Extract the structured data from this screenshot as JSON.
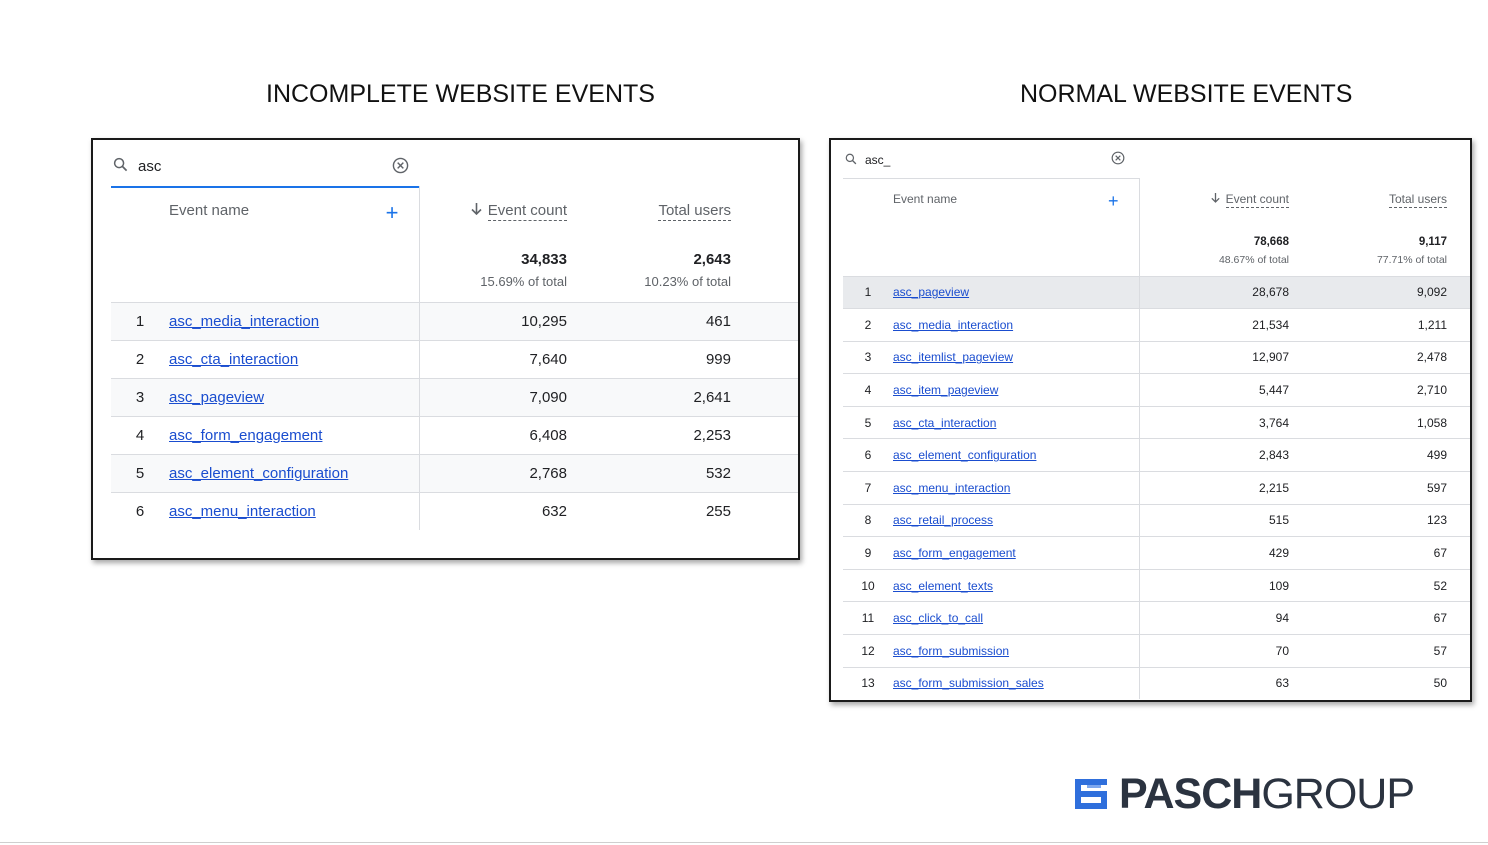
{
  "left": {
    "heading": "INCOMPLETE WEBSITE EVENTS",
    "search_value": "asc",
    "col_event_name": "Event name",
    "col_event_count": "Event count",
    "col_total_users": "Total users",
    "total_event_count": "34,833",
    "total_event_count_pct": "15.69% of total",
    "total_users": "2,643",
    "total_users_pct": "10.23% of total",
    "rows": [
      {
        "idx": "1",
        "name": "asc_media_interaction",
        "count": "10,295",
        "users": "461"
      },
      {
        "idx": "2",
        "name": "asc_cta_interaction",
        "count": "7,640",
        "users": "999"
      },
      {
        "idx": "3",
        "name": "asc_pageview",
        "count": "7,090",
        "users": "2,641"
      },
      {
        "idx": "4",
        "name": "asc_form_engagement",
        "count": "6,408",
        "users": "2,253"
      },
      {
        "idx": "5",
        "name": "asc_element_configuration",
        "count": "2,768",
        "users": "532"
      },
      {
        "idx": "6",
        "name": "asc_menu_interaction",
        "count": "632",
        "users": "255"
      }
    ]
  },
  "right": {
    "heading": "NORMAL WEBSITE EVENTS",
    "search_value": "asc_",
    "col_event_name": "Event name",
    "col_event_count": "Event count",
    "col_total_users": "Total users",
    "total_event_count": "78,668",
    "total_event_count_pct": "48.67% of total",
    "total_users": "9,117",
    "total_users_pct": "77.71% of total",
    "rows": [
      {
        "idx": "1",
        "name": "asc_pageview",
        "count": "28,678",
        "users": "9,092"
      },
      {
        "idx": "2",
        "name": "asc_media_interaction",
        "count": "21,534",
        "users": "1,211"
      },
      {
        "idx": "3",
        "name": "asc_itemlist_pageview",
        "count": "12,907",
        "users": "2,478"
      },
      {
        "idx": "4",
        "name": "asc_item_pageview",
        "count": "5,447",
        "users": "2,710"
      },
      {
        "idx": "5",
        "name": "asc_cta_interaction",
        "count": "3,764",
        "users": "1,058"
      },
      {
        "idx": "6",
        "name": "asc_element_configuration",
        "count": "2,843",
        "users": "499"
      },
      {
        "idx": "7",
        "name": "asc_menu_interaction",
        "count": "2,215",
        "users": "597"
      },
      {
        "idx": "8",
        "name": "asc_retail_process",
        "count": "515",
        "users": "123"
      },
      {
        "idx": "9",
        "name": "asc_form_engagement",
        "count": "429",
        "users": "67"
      },
      {
        "idx": "10",
        "name": "asc_element_texts",
        "count": "109",
        "users": "52"
      },
      {
        "idx": "11",
        "name": "asc_click_to_call",
        "count": "94",
        "users": "67"
      },
      {
        "idx": "12",
        "name": "asc_form_submission",
        "count": "70",
        "users": "57"
      },
      {
        "idx": "13",
        "name": "asc_form_submission_sales",
        "count": "63",
        "users": "50"
      }
    ]
  },
  "icons": {
    "search": "search-icon",
    "clear": "clear-circle-icon",
    "sort": "arrow-down-icon",
    "add": "plus-icon"
  },
  "colors": {
    "link": "#1a4dcf",
    "accent": "#1a73e8",
    "logo_blue": "#2f6fdc",
    "logo_text": "#2b3340"
  },
  "logo": {
    "bold": "PASCH",
    "thin": "GROUP"
  }
}
